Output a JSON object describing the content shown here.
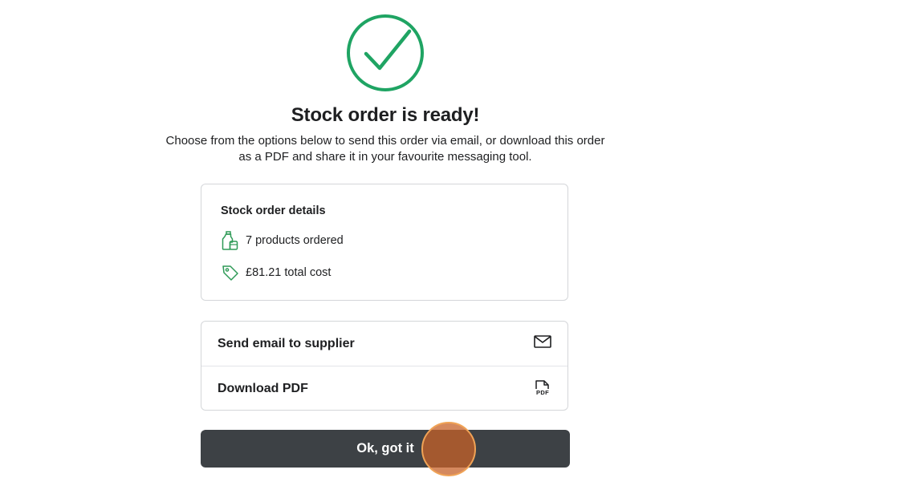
{
  "dialog": {
    "title": "Stock order is ready!",
    "subtitle": "Choose from the options below to send this order via email, or download this order as a PDF and share it in your favourite messaging tool."
  },
  "details": {
    "heading": "Stock order details",
    "items": [
      {
        "icon": "products-bottle-icon",
        "label": "7 products ordered"
      },
      {
        "icon": "price-tag-icon",
        "label": "£81.21 total cost"
      }
    ]
  },
  "actions": [
    {
      "label": "Send email to supplier",
      "icon": "envelope-icon"
    },
    {
      "label": "Download PDF",
      "icon": "pdf-file-icon",
      "icon_text": "PDF"
    }
  ],
  "confirm_button": {
    "label": "Ok, got it"
  },
  "colors": {
    "success_green": "#1fa463",
    "icon_green": "#2e9a57",
    "button_dark": "#3d4145",
    "click_indicator": "#c76228"
  }
}
